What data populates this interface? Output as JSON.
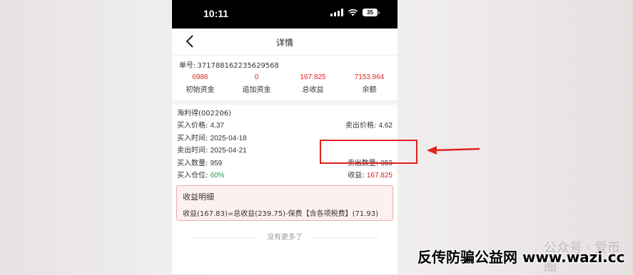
{
  "status_bar": {
    "time": "10:11",
    "battery": "35"
  },
  "nav": {
    "title": "详情"
  },
  "order": {
    "label": "单号:",
    "number": "371788162235629568"
  },
  "stats": [
    {
      "value": "6986",
      "label": "初始资金"
    },
    {
      "value": "0",
      "label": "追加资金"
    },
    {
      "value": "167.825",
      "label": "总收益"
    },
    {
      "value": "7153.964",
      "label": "余额"
    }
  ],
  "detail": {
    "stock": "海利得(002206)",
    "buy_price_label": "买入价格:",
    "buy_price": "4.37",
    "sell_price_label": "卖出价格:",
    "sell_price": "4.62",
    "buy_time_label": "买入时间:",
    "buy_time": "2025-04-18",
    "sell_time_label": "卖出时间:",
    "sell_time": "2025-04-21",
    "buy_qty_label": "买入数量:",
    "buy_qty": "959",
    "sell_qty_label": "卖出数量:",
    "sell_qty": "959",
    "position_label": "买入仓位:",
    "position": "60%",
    "profit_label": "收益:",
    "profit": "167.825"
  },
  "breakdown": {
    "title": "收益明细",
    "text": "收益(167.83)=总收益(239.75)-保费【含各项税费】(71.93)"
  },
  "footer": {
    "no_more": "没有更多了"
  },
  "watermark": {
    "wechat": "公众号 · 爱币圈",
    "site": "反传防骗公益网 www.wazi.cc"
  },
  "colors": {
    "accent_red": "#e32222",
    "green": "#1f9a4a",
    "annotation_red": "#e0211f"
  }
}
